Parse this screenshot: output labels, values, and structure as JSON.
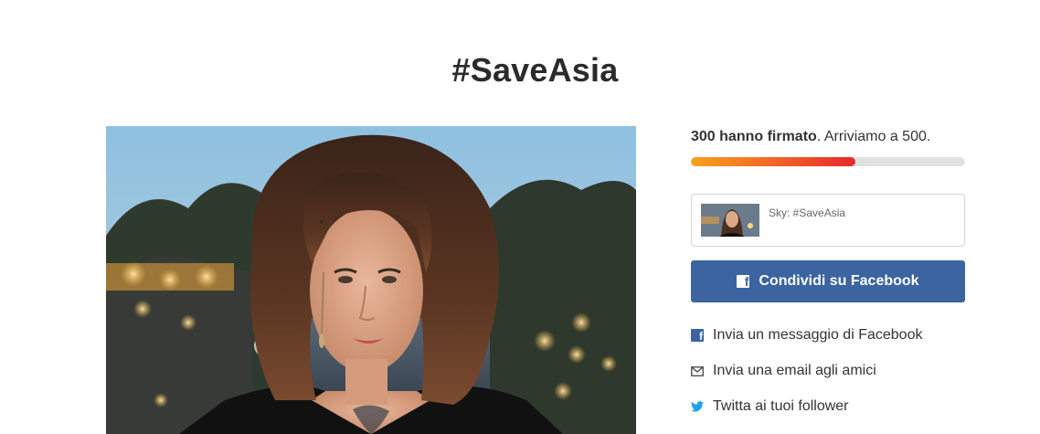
{
  "page": {
    "title": "#SaveAsia"
  },
  "petition": {
    "signed_count_text": "300 hanno firmato",
    "goal_text": ". Arriviamo a 500.",
    "signed": 300,
    "goal": 500,
    "progress_fraction": 0.6
  },
  "share_card": {
    "text": "Sky: #SaveAsia"
  },
  "facebook_button": {
    "label": "Condividi su Facebook"
  },
  "share_options": [
    {
      "label": "Invia un messaggio di Facebook",
      "icon": "facebook-icon"
    },
    {
      "label": "Invia una email agli amici",
      "icon": "envelope-icon"
    },
    {
      "label": "Twitta ai tuoi follower",
      "icon": "twitter-icon"
    }
  ],
  "colors": {
    "facebook_blue": "#3b64a0",
    "progress_start": "#f8a21c",
    "progress_end": "#e42a2a",
    "twitter_blue": "#1da1f2"
  }
}
